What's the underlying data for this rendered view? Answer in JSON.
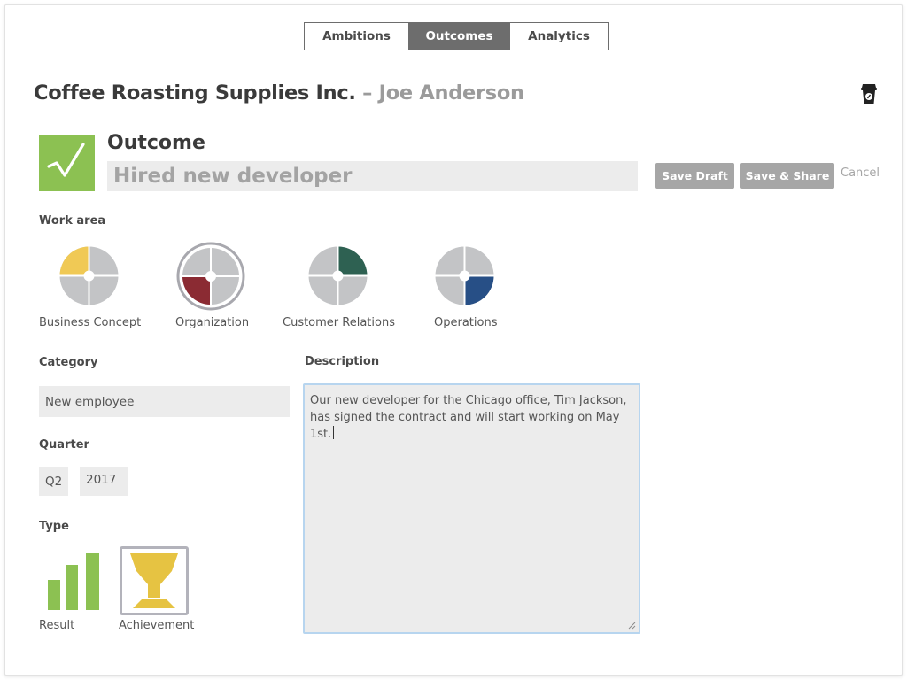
{
  "tabs": [
    {
      "label": "Ambitions",
      "active": false
    },
    {
      "label": "Outcomes",
      "active": true
    },
    {
      "label": "Analytics",
      "active": false
    }
  ],
  "header": {
    "company": "Coffee Roasting Supplies Inc.",
    "separator": " – ",
    "person": "Joe Anderson",
    "icon": "coffee-cup-icon"
  },
  "outcome": {
    "label": "Outcome",
    "badge_icon": "checkmark-icon",
    "badge_color": "#8cc152",
    "title_value": "Hired new developer"
  },
  "actions": {
    "save_draft": "Save Draft",
    "save_share": "Save & Share",
    "cancel": "Cancel"
  },
  "work_area": {
    "label": "Work area",
    "items": [
      {
        "label": "Business Concept",
        "color": "#f0c955",
        "selected": false
      },
      {
        "label": "Organization",
        "color": "#8b2b33",
        "selected": true
      },
      {
        "label": "Customer Relations",
        "color": "#2e6152",
        "selected": false
      },
      {
        "label": "Operations",
        "color": "#274f86",
        "selected": false
      }
    ]
  },
  "category": {
    "label": "Category",
    "value": "New employee"
  },
  "quarter": {
    "label": "Quarter",
    "quarter_value": "Q2",
    "year_value": "2017"
  },
  "description": {
    "label": "Description",
    "value_line1": "Our new developer for the Chicago office, Tim Jackson,",
    "value_line2": "has signed the contract and will start working on May 1st."
  },
  "type": {
    "label": "Type",
    "items": [
      {
        "label": "Result",
        "icon": "bar-chart-icon",
        "selected": false,
        "color": "#8cc152"
      },
      {
        "label": "Achievement",
        "icon": "trophy-icon",
        "selected": true,
        "color": "#e6c342"
      }
    ]
  }
}
